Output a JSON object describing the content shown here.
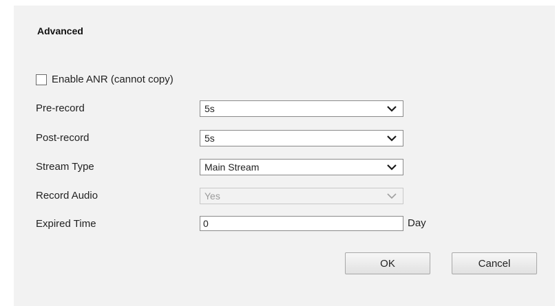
{
  "section": {
    "title": "Advanced"
  },
  "enable_anr": {
    "label": "Enable ANR (cannot copy)",
    "checked": false
  },
  "fields": {
    "pre_record": {
      "label": "Pre-record",
      "value": "5s"
    },
    "post_record": {
      "label": "Post-record",
      "value": "5s"
    },
    "stream_type": {
      "label": "Stream Type",
      "value": "Main Stream"
    },
    "record_audio": {
      "label": "Record Audio",
      "value": "Yes",
      "disabled": true
    },
    "expired_time": {
      "label": "Expired Time",
      "value": "0",
      "unit": "Day"
    }
  },
  "buttons": {
    "ok": "OK",
    "cancel": "Cancel"
  },
  "icons": {
    "dropdown": "chevron-down-icon",
    "checkbox": "checkbox-unchecked"
  }
}
